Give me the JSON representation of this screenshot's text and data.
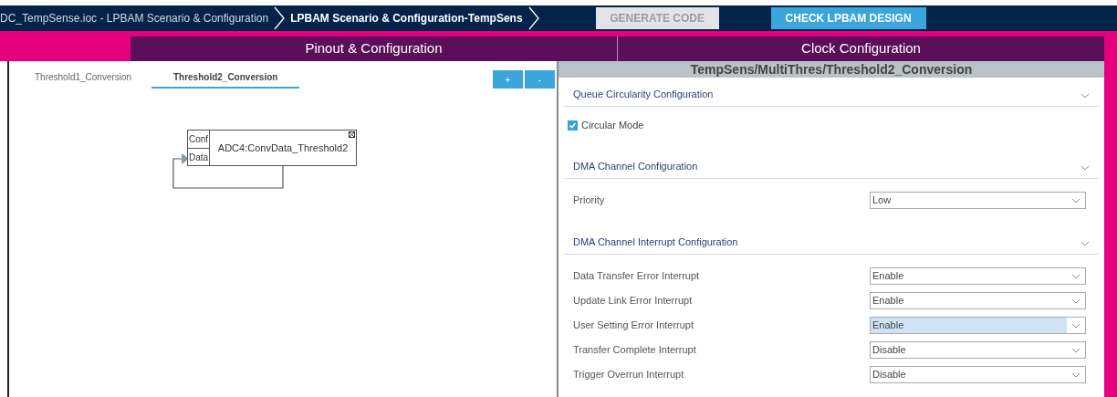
{
  "breadcrumbs": [
    {
      "label": "DC_TempSense.ioc - LPBAM Scenario & Configuration",
      "selected": false
    },
    {
      "label": "LPBAM Scenario & Configuration-TempSens",
      "selected": true
    }
  ],
  "toolbar_buttons": [
    {
      "label": "GENERATE CODE",
      "disabled": true
    },
    {
      "label": "CHECK LPBAM DESIGN",
      "disabled": false
    }
  ],
  "main_tabs": [
    {
      "label": "Pinout & Configuration",
      "selected": false
    },
    {
      "label": "Clock Configuration",
      "selected": false
    }
  ],
  "scenario_tabs": [
    {
      "label": "Threshold1_Conversion",
      "selected": false
    },
    {
      "label": "Threshold2_Conversion",
      "selected": true
    }
  ],
  "scenario_buttons": [
    "+",
    "-"
  ],
  "diagram": {
    "node": {
      "ports": [
        "Conf",
        "Data"
      ],
      "label": "ADC4:ConvData_Threshold2"
    }
  },
  "panel": {
    "title": "TempSens/MultiThres/Threshold2_Conversion",
    "sections": [
      {
        "title": "Queue Circularity Configuration",
        "expanded": true,
        "rows": [
          {
            "kind": "checkbox",
            "label": "Circular Mode",
            "checked": true
          }
        ]
      },
      {
        "title": "DMA Channel Configuration",
        "expanded": true,
        "rows": [
          {
            "kind": "select",
            "label": "Priority",
            "value": "Low",
            "highlighted": false
          }
        ]
      },
      {
        "title": "DMA Channel Interrupt Configuration",
        "expanded": true,
        "rows": [
          {
            "kind": "select",
            "label": "Data Transfer Error Interrupt",
            "value": "Enable",
            "highlighted": false
          },
          {
            "kind": "select",
            "label": "Update Link Error Interrupt",
            "value": "Enable",
            "highlighted": false
          },
          {
            "kind": "select",
            "label": "User Setting Error Interrupt",
            "value": "Enable",
            "highlighted": true
          },
          {
            "kind": "select",
            "label": "Transfer Complete Interrupt",
            "value": "Disable",
            "highlighted": false
          },
          {
            "kind": "select",
            "label": "Trigger Overrun Interrupt",
            "value": "Disable",
            "highlighted": false
          }
        ]
      }
    ]
  }
}
